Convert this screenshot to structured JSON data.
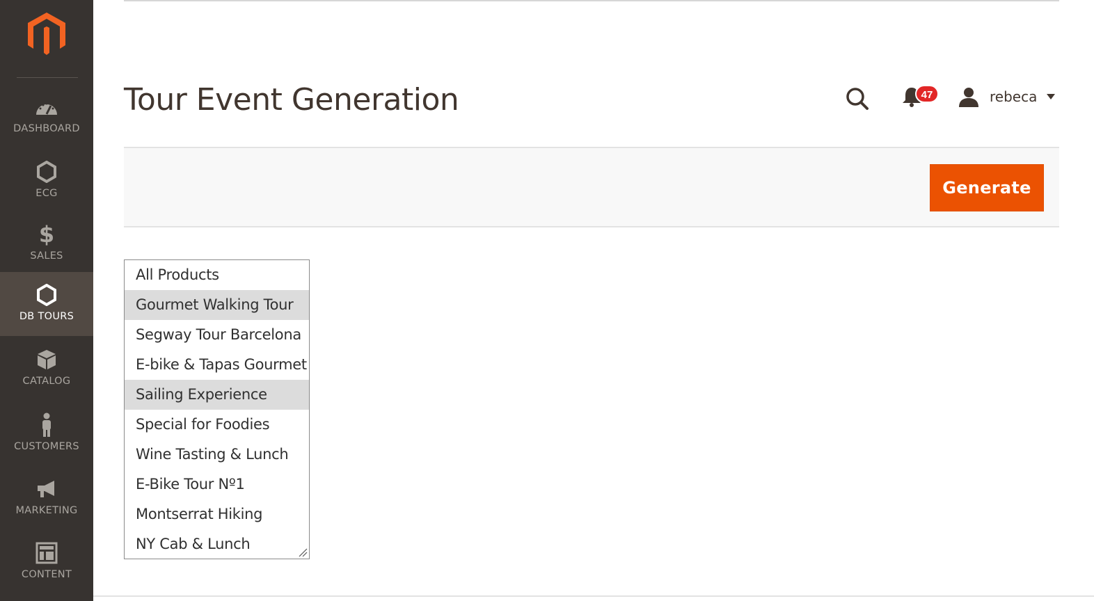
{
  "sidebar": {
    "items": [
      {
        "label": "DASHBOARD",
        "icon": "dashboard-icon"
      },
      {
        "label": "ECG",
        "icon": "hexagon-icon"
      },
      {
        "label": "SALES",
        "icon": "dollar-icon"
      },
      {
        "label": "DB TOURS",
        "icon": "hexagon-icon",
        "active": true
      },
      {
        "label": "CATALOG",
        "icon": "box-icon"
      },
      {
        "label": "CUSTOMERS",
        "icon": "person-icon"
      },
      {
        "label": "MARKETING",
        "icon": "megaphone-icon"
      },
      {
        "label": "CONTENT",
        "icon": "layout-icon"
      }
    ]
  },
  "header": {
    "title": "Tour Event Generation",
    "notifications_count": "47",
    "user_name": "rebeca"
  },
  "actions": {
    "generate_label": "Generate"
  },
  "product_list": {
    "options": [
      {
        "label": "All Products",
        "selected": false
      },
      {
        "label": "Gourmet Walking Tour",
        "selected": true
      },
      {
        "label": "Segway Tour Barcelona",
        "selected": false
      },
      {
        "label": "E-bike & Tapas Gourmet",
        "selected": false
      },
      {
        "label": "Sailing Experience",
        "selected": true
      },
      {
        "label": "Special for Foodies",
        "selected": false
      },
      {
        "label": "Wine Tasting & Lunch",
        "selected": false
      },
      {
        "label": "E-Bike Tour Nº1",
        "selected": false
      },
      {
        "label": "Montserrat Hiking",
        "selected": false
      },
      {
        "label": "NY Cab & Lunch",
        "selected": false
      }
    ]
  },
  "colors": {
    "sidebar_bg": "#373330",
    "sidebar_active": "#514943",
    "accent": "#eb5202",
    "badge": "#e22626"
  }
}
